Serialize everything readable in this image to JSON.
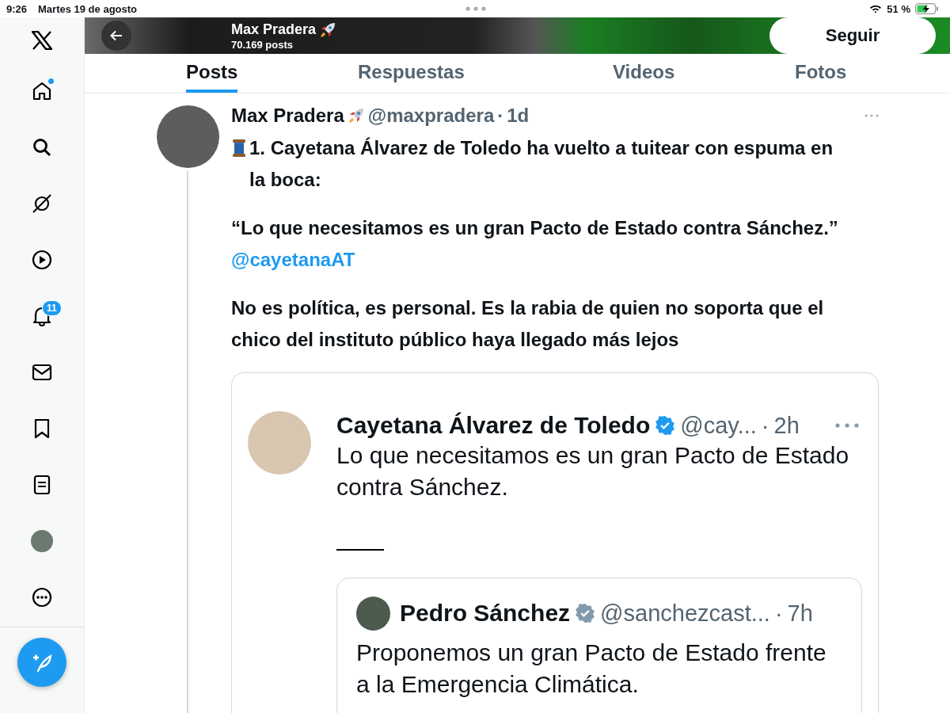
{
  "status_bar": {
    "time": "9:26",
    "date": "Martes 19 de agosto",
    "battery": "51 %"
  },
  "sidebar": {
    "items": [
      {
        "kind": "home",
        "unread": true
      },
      {
        "kind": "search",
        "unread": false
      },
      {
        "kind": "grok",
        "unread": false
      },
      {
        "kind": "video",
        "unread": false
      },
      {
        "kind": "notifications",
        "unread": false,
        "badge": "11"
      },
      {
        "kind": "messages",
        "unread": false
      },
      {
        "kind": "bookmarks",
        "unread": false
      },
      {
        "kind": "lists",
        "unread": false
      },
      {
        "kind": "profile",
        "unread": false
      },
      {
        "kind": "more",
        "unread": false
      }
    ]
  },
  "header": {
    "name": "Max Pradera",
    "posts": "70.169 posts",
    "follow_button": "Seguir"
  },
  "tabs": [
    {
      "label": "Posts",
      "selected": true
    },
    {
      "label": "Respuestas",
      "selected": false
    },
    {
      "label": "Videos",
      "selected": false
    },
    {
      "label": "Fotos",
      "selected": false
    }
  ],
  "post": {
    "name": "Max Pradera",
    "handle": "@maxpradera",
    "separator": "·",
    "time": "1d",
    "paragraphs": [
      {
        "text": "1. Cayetana Álvarez de Toledo ha vuelto a tuitear con espuma en la boca:"
      },
      {
        "text": "“Lo que necesitamos es un gran Pacto de Estado contra Sánchez.”",
        "mention": "@cayetanaAT"
      },
      {
        "text": "No es política, es personal. Es la rabia de quien no soporta que el chico del instituto público haya llegado más lejos"
      }
    ],
    "quote": {
      "name": "Cayetana Álvarez de Toledo",
      "verified": true,
      "handle": "@cay...",
      "separator": "·",
      "time": "2h",
      "text": "Lo que necesitamos es un gran Pacto de Estado contra Sánchez.",
      "quote": {
        "name": "Pedro Sánchez",
        "verified": true,
        "handle": "@sanchezcast...",
        "separator": "·",
        "time": "7h",
        "text": "Proponemos un gran Pacto de Estado frente a la Emergencia Climática."
      }
    }
  }
}
